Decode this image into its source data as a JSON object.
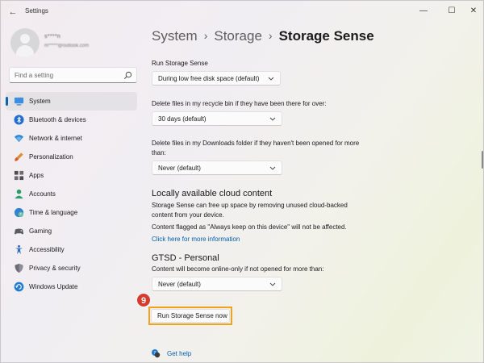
{
  "window": {
    "title": "Settings",
    "back_icon": "back-arrow-icon",
    "minimize_icon": "minimize-icon",
    "maximize_icon": "maximize-icon",
    "close_icon": "close-icon"
  },
  "profile": {
    "name": "s****n",
    "email": "m*****@outlook.com"
  },
  "search": {
    "placeholder": "Find a setting"
  },
  "sidebar": {
    "accent": "#0067c0",
    "items": [
      {
        "label": "System",
        "icon": "system-display-icon",
        "selected": true
      },
      {
        "label": "Bluetooth & devices",
        "icon": "bluetooth-icon"
      },
      {
        "label": "Network & internet",
        "icon": "wifi-icon"
      },
      {
        "label": "Personalization",
        "icon": "paintbrush-icon"
      },
      {
        "label": "Apps",
        "icon": "apps-grid-icon"
      },
      {
        "label": "Accounts",
        "icon": "person-icon"
      },
      {
        "label": "Time & language",
        "icon": "globe-clock-icon"
      },
      {
        "label": "Gaming",
        "icon": "gamepad-icon"
      },
      {
        "label": "Accessibility",
        "icon": "accessibility-icon"
      },
      {
        "label": "Privacy & security",
        "icon": "shield-icon"
      },
      {
        "label": "Windows Update",
        "icon": "windows-update-icon"
      }
    ]
  },
  "breadcrumb": {
    "items": [
      "System",
      "Storage"
    ],
    "current": "Storage Sense",
    "separator": "›"
  },
  "main": {
    "run_label": "Run Storage Sense",
    "run_value": "During low free disk space (default)",
    "recycle_label": "Delete files in my recycle bin if they have been there for over:",
    "recycle_value": "30 days (default)",
    "downloads_label": "Delete files in my Downloads folder if they haven't been opened for more than:",
    "downloads_value": "Never (default)",
    "cloud_heading": "Locally available cloud content",
    "cloud_desc": "Storage Sense can free up space by removing unused cloud-backed content from your device.",
    "cloud_note": "Content flagged as \"Always keep on this device\" will not be affected.",
    "cloud_link": "Click here for more information",
    "gtsd_heading": "GTSD - Personal",
    "gtsd_desc": "Content will become online-only if not opened for more than:",
    "gtsd_value": "Never (default)",
    "step_badge": "9",
    "run_now_button": "Run Storage Sense now",
    "get_help": "Get help"
  },
  "colors": {
    "link": "#005fb8",
    "badge": "#d93a2b",
    "highlight": "#f0a21b"
  }
}
